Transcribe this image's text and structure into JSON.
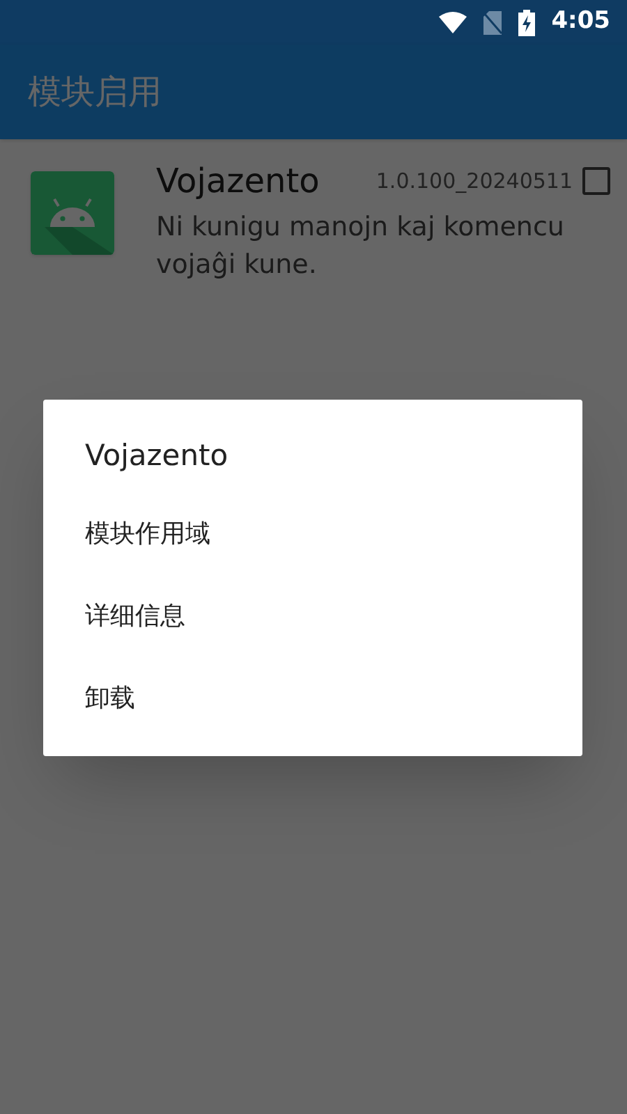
{
  "status_bar": {
    "time": "4:05"
  },
  "app_bar": {
    "title": "模块启用"
  },
  "modules": [
    {
      "name": "Vojazento",
      "version": "1.0.100_20240511",
      "description": "Ni kunigu manojn kaj komencu vojaĝi kune.",
      "checked": false
    }
  ],
  "dialog": {
    "title": "Vojazento",
    "items": [
      "模块作用域",
      "详细信息",
      "卸载"
    ]
  }
}
